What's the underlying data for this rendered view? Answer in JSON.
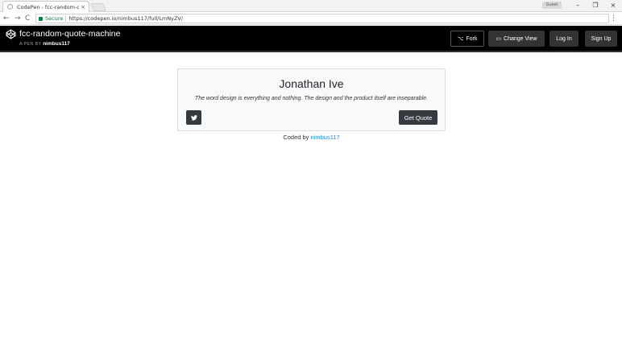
{
  "browser": {
    "tab_title": "CodePen - fcc-random-q",
    "tab_close": "×",
    "user_chip": "Guest",
    "window_controls": [
      "–",
      "❐",
      "×"
    ],
    "back": "←",
    "forward": "→",
    "reload": "C",
    "secure_label": "Secure",
    "url": "https://codepen.io/nimbus117/full/LmNyZV/",
    "menu": "⋮"
  },
  "header": {
    "pen_title": "fcc-random-quote-machine",
    "by_prefix": "A PEN BY",
    "author": "nimbus117",
    "buttons": {
      "fork": "Fork",
      "change_view": "Change View",
      "login": "Log In",
      "signup": "Sign Up"
    }
  },
  "quote": {
    "author": "Jonathan Ive",
    "text": "The word design is everything and nothing. The design and the product itself are inseparable.",
    "get_quote_label": "Get Quote"
  },
  "footer": {
    "coded_by": "Coded by",
    "coder": "nimbus117"
  },
  "icons": {
    "codepen": "codepen-icon",
    "tweet": "twitter-icon",
    "fork": "fork-icon",
    "change_view": "layout-icon"
  }
}
